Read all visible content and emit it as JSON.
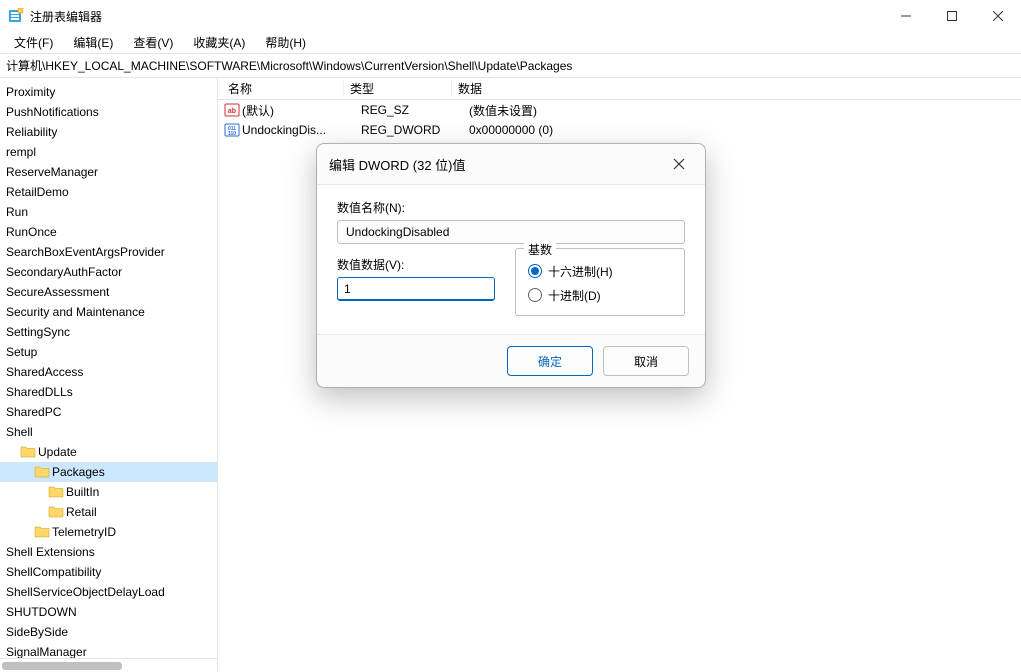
{
  "title": "注册表编辑器",
  "menu": [
    "文件(F)",
    "编辑(E)",
    "查看(V)",
    "收藏夹(A)",
    "帮助(H)"
  ],
  "address": "计算机\\HKEY_LOCAL_MACHINE\\SOFTWARE\\Microsoft\\Windows\\CurrentVersion\\Shell\\Update\\Packages",
  "tree": [
    {
      "label": "Proximity",
      "indent": 0,
      "icon": false
    },
    {
      "label": "PushNotifications",
      "indent": 0,
      "icon": false
    },
    {
      "label": "Reliability",
      "indent": 0,
      "icon": false
    },
    {
      "label": "rempl",
      "indent": 0,
      "icon": false
    },
    {
      "label": "ReserveManager",
      "indent": 0,
      "icon": false
    },
    {
      "label": "RetailDemo",
      "indent": 0,
      "icon": false
    },
    {
      "label": "Run",
      "indent": 0,
      "icon": false
    },
    {
      "label": "RunOnce",
      "indent": 0,
      "icon": false
    },
    {
      "label": "SearchBoxEventArgsProvider",
      "indent": 0,
      "icon": false
    },
    {
      "label": "SecondaryAuthFactor",
      "indent": 0,
      "icon": false
    },
    {
      "label": "SecureAssessment",
      "indent": 0,
      "icon": false
    },
    {
      "label": "Security and Maintenance",
      "indent": 0,
      "icon": false
    },
    {
      "label": "SettingSync",
      "indent": 0,
      "icon": false
    },
    {
      "label": "Setup",
      "indent": 0,
      "icon": false
    },
    {
      "label": "SharedAccess",
      "indent": 0,
      "icon": false
    },
    {
      "label": "SharedDLLs",
      "indent": 0,
      "icon": false
    },
    {
      "label": "SharedPC",
      "indent": 0,
      "icon": false
    },
    {
      "label": "Shell",
      "indent": 0,
      "icon": false
    },
    {
      "label": "Update",
      "indent": 1,
      "icon": true
    },
    {
      "label": "Packages",
      "indent": 2,
      "icon": true,
      "selected": true
    },
    {
      "label": "BuiltIn",
      "indent": 3,
      "icon": true
    },
    {
      "label": "Retail",
      "indent": 3,
      "icon": true
    },
    {
      "label": "TelemetryID",
      "indent": 2,
      "icon": true
    },
    {
      "label": "Shell Extensions",
      "indent": 0,
      "icon": false
    },
    {
      "label": "ShellCompatibility",
      "indent": 0,
      "icon": false
    },
    {
      "label": "ShellServiceObjectDelayLoad",
      "indent": 0,
      "icon": false
    },
    {
      "label": "SHUTDOWN",
      "indent": 0,
      "icon": false
    },
    {
      "label": "SideBySide",
      "indent": 0,
      "icon": false
    },
    {
      "label": "SignalManager",
      "indent": 0,
      "icon": false
    }
  ],
  "list_headers": {
    "name": "名称",
    "type": "类型",
    "data": "数据"
  },
  "rows": [
    {
      "icon": "sz",
      "name": "(默认)",
      "type": "REG_SZ",
      "data": "(数值未设置)"
    },
    {
      "icon": "bin",
      "name": "UndockingDis...",
      "type": "REG_DWORD",
      "data": "0x00000000 (0)"
    }
  ],
  "dialog": {
    "title": "编辑 DWORD (32 位)值",
    "name_label": "数值名称(N):",
    "name_value": "UndockingDisabled",
    "data_label": "数值数据(V):",
    "data_value": "1",
    "radix_label": "基数",
    "hex": "十六进制(H)",
    "dec": "十进制(D)",
    "ok": "确定",
    "cancel": "取消"
  }
}
